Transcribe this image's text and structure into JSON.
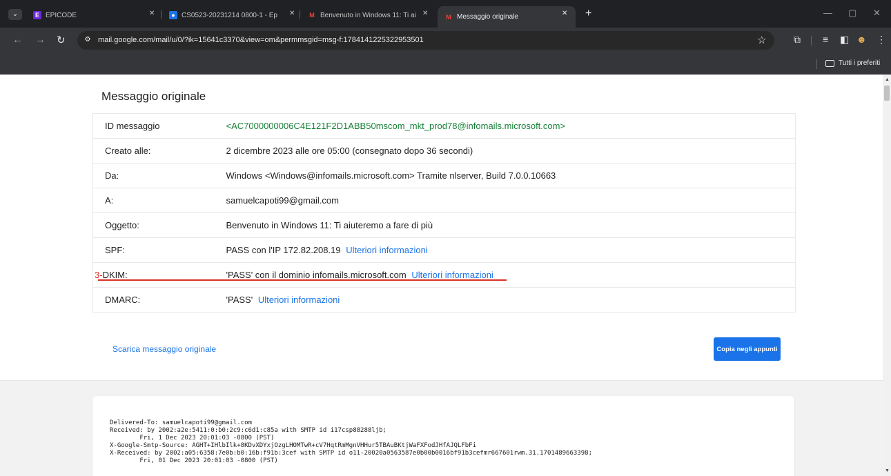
{
  "browser": {
    "tabs": [
      {
        "title": "EPICODE",
        "favicon": "epicode-icon",
        "active": false
      },
      {
        "title": "CS0523-20231214 0800-1 - Ep",
        "favicon": "meeting-icon",
        "active": false
      },
      {
        "title": "Benvenuto in Windows 11: Ti ai",
        "favicon": "gmail-icon",
        "active": false
      },
      {
        "title": "Messaggio originale",
        "favicon": "gmail-icon",
        "active": true
      }
    ],
    "url": "mail.google.com/mail/u/0/?ik=15641c3370&view=om&permmsgid=msg-f:1784141225322953501",
    "bookmarks_folder": "Tutti i preferiti"
  },
  "page": {
    "title": "Messaggio originale",
    "rows": [
      {
        "label": "ID messaggio",
        "value": "<AC7000000006C4E121F2D1ABB50mscom_mkt_prod78@infomails.microsoft.com>"
      },
      {
        "label": "Creato alle:",
        "value": "2 dicembre 2023 alle ore 05:00 (consegnato dopo 36 secondi)"
      },
      {
        "label": "Da:",
        "value": "Windows <Windows@infomails.microsoft.com> Tramite nlserver, Build 7.0.0.10663"
      },
      {
        "label": "A:",
        "value": "samuelcapoti99@gmail.com"
      },
      {
        "label": "Oggetto:",
        "value": "Benvenuto in Windows 11: Ti aiuteremo a fare di più"
      },
      {
        "label": "SPF:",
        "value": "PASS con l'IP 172.82.208.19",
        "link": "Ulteriori informazioni"
      },
      {
        "label": "DKIM:",
        "value": "'PASS' con il dominio infomails.microsoft.com",
        "link": "Ulteriori informazioni",
        "annotation": "3-"
      },
      {
        "label": "DMARC:",
        "value": "'PASS'",
        "link": "Ulteriori informazioni"
      }
    ],
    "download_link": "Scarica messaggio originale",
    "copy_button": "Copia negli appunti",
    "raw_source": [
      "Delivered-To: samuelcapoti99@gmail.com",
      "Received: by 2002:a2e:5411:0:b0:2c9:c6d1:c85a with SMTP id i17csp88288ljb;",
      "        Fri, 1 Dec 2023 20:01:03 -0800 (PST)",
      "X-Google-Smtp-Source: AGHT+IHlbIlk+8KDvXDYxjOzgLHOMTwR+cV7HqtRmMgnVHHur5TBAuBKtjWaFXFodJHfAJQLFbFi",
      "X-Received: by 2002:a05:6358:7e0b:b0:16b:f91b:3cef with SMTP id o11-20020a0563587e0b00b0016bf91b3cefmr667601rwm.31.1701489663398;",
      "        Fri, 01 Dec 2023 20:01:03 -0800 (PST)"
    ]
  },
  "colors": {
    "accent": "#1a73e8",
    "message_id": "#188038",
    "annotation": "#d93025"
  }
}
